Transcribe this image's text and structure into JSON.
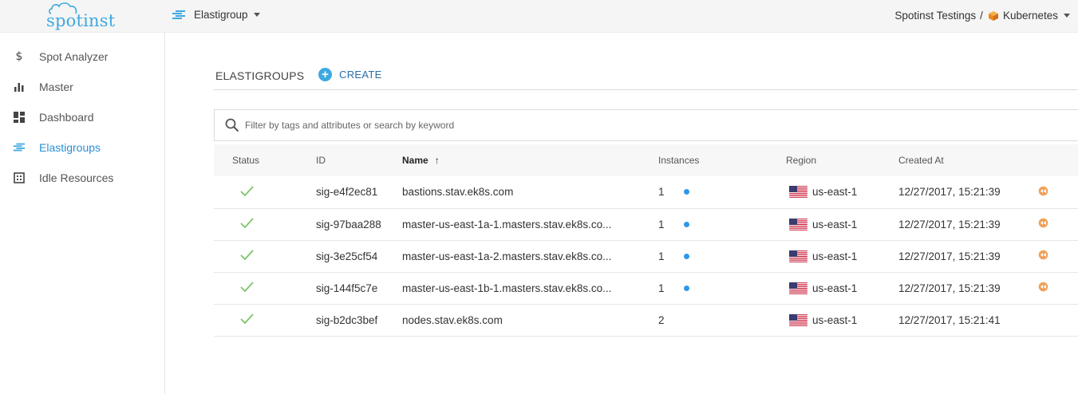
{
  "topbar": {
    "logo_text": "spotinst",
    "product_switcher": "Elastigroup",
    "account": "Spotinst Testings",
    "account_separator": "/",
    "environment": "Kubernetes"
  },
  "sidebar": {
    "items": [
      {
        "label": "Spot Analyzer",
        "icon": "dollar-icon",
        "active": false
      },
      {
        "label": "Master",
        "icon": "bar-chart-icon",
        "active": false
      },
      {
        "label": "Dashboard",
        "icon": "dashboard-icon",
        "active": false
      },
      {
        "label": "Elastigroups",
        "icon": "elastigroup-icon",
        "active": true
      },
      {
        "label": "Idle Resources",
        "icon": "idle-resources-icon",
        "active": false
      }
    ]
  },
  "main": {
    "title": "ELASTIGROUPS",
    "create_label": "CREATE",
    "search_placeholder": "Filter by tags and attributes or search by keyword",
    "search_value": "",
    "columns": {
      "status": "Status",
      "id": "ID",
      "name": "Name",
      "instances": "Instances",
      "region": "Region",
      "created": "Created At"
    },
    "sort_indicator": "↑",
    "rows": [
      {
        "status": "ok",
        "id": "sig-e4f2ec81",
        "name": "bastions.stav.ek8s.com",
        "instances": "1",
        "running_dot": true,
        "region": "us-east-1",
        "created": "12/27/2017, 15:21:39",
        "action": true
      },
      {
        "status": "ok",
        "id": "sig-97baa288",
        "name": "master-us-east-1a-1.masters.stav.ek8s.co...",
        "instances": "1",
        "running_dot": true,
        "region": "us-east-1",
        "created": "12/27/2017, 15:21:39",
        "action": true
      },
      {
        "status": "ok",
        "id": "sig-3e25cf54",
        "name": "master-us-east-1a-2.masters.stav.ek8s.co...",
        "instances": "1",
        "running_dot": true,
        "region": "us-east-1",
        "created": "12/27/2017, 15:21:39",
        "action": true
      },
      {
        "status": "ok",
        "id": "sig-144f5c7e",
        "name": "master-us-east-1b-1.masters.stav.ek8s.co...",
        "instances": "1",
        "running_dot": true,
        "region": "us-east-1",
        "created": "12/27/2017, 15:21:39",
        "action": true
      },
      {
        "status": "ok",
        "id": "sig-b2dc3bef",
        "name": "nodes.stav.ek8s.com",
        "instances": "2",
        "running_dot": false,
        "region": "us-east-1",
        "created": "12/27/2017, 15:21:41",
        "action": false
      }
    ]
  },
  "colors": {
    "accent": "#3ea9e0",
    "active_nav": "#2a8fd6",
    "status_ok": "#7dc46c",
    "instance_dot": "#2f97e8",
    "action_icon": "#f0a05a"
  }
}
